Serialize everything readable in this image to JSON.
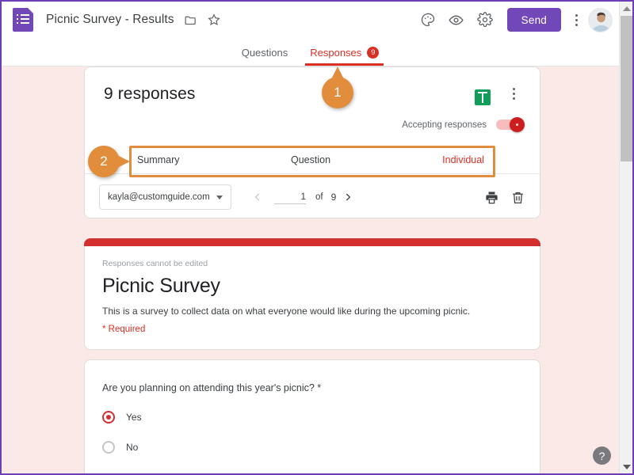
{
  "app": {
    "doc_title": "Picnic Survey - Results",
    "logo_icon": "google-forms-icon",
    "move_folder_icon": "folder-icon",
    "star_icon": "star-icon"
  },
  "toolbar": {
    "theme_icon": "palette-icon",
    "preview_icon": "eye-icon",
    "settings_icon": "gear-icon",
    "send_label": "Send",
    "more_icon": "kebab-menu-icon",
    "avatar": "user-avatar"
  },
  "tabs": [
    {
      "label": "Questions",
      "active": false,
      "badge": null
    },
    {
      "label": "Responses",
      "active": true,
      "badge": "9"
    }
  ],
  "responses_card": {
    "count_label": "9 responses",
    "sheets_icon": "google-sheets-icon",
    "more_icon": "kebab-menu-icon",
    "accepting_label": "Accepting responses",
    "accepting_on": true,
    "subtabs": [
      {
        "label": "Summary",
        "active": false
      },
      {
        "label": "Question",
        "active": false
      },
      {
        "label": "Individual",
        "active": true
      }
    ],
    "respondent_email": "kayla@customguide.com",
    "dropdown_icon": "chevron-down-icon",
    "prev_icon": "chevron-left-icon",
    "next_icon": "chevron-right-icon",
    "page_current": "1",
    "page_of_label": "of",
    "page_total": "9",
    "print_icon": "printer-icon",
    "delete_icon": "trash-icon"
  },
  "survey_header": {
    "note": "Responses cannot be edited",
    "title": "Picnic Survey",
    "description": "This is a survey to collect data on what everyone would like during the upcoming picnic.",
    "required_note": "* Required"
  },
  "question_card": {
    "question": "Are you planning on attending this year's picnic? *",
    "options": [
      {
        "label": "Yes",
        "selected": true
      },
      {
        "label": "No",
        "selected": false
      }
    ]
  },
  "callouts": [
    {
      "number": "1"
    },
    {
      "number": "2"
    }
  ],
  "help": {
    "label": "?"
  },
  "colors": {
    "brand_purple": "#7248b9",
    "accent_red": "#d93025",
    "header_bar_red": "#d32f2f",
    "sheets_green": "#0f9d58",
    "callout_orange": "#e28d3c",
    "page_background": "#fae9e7"
  }
}
